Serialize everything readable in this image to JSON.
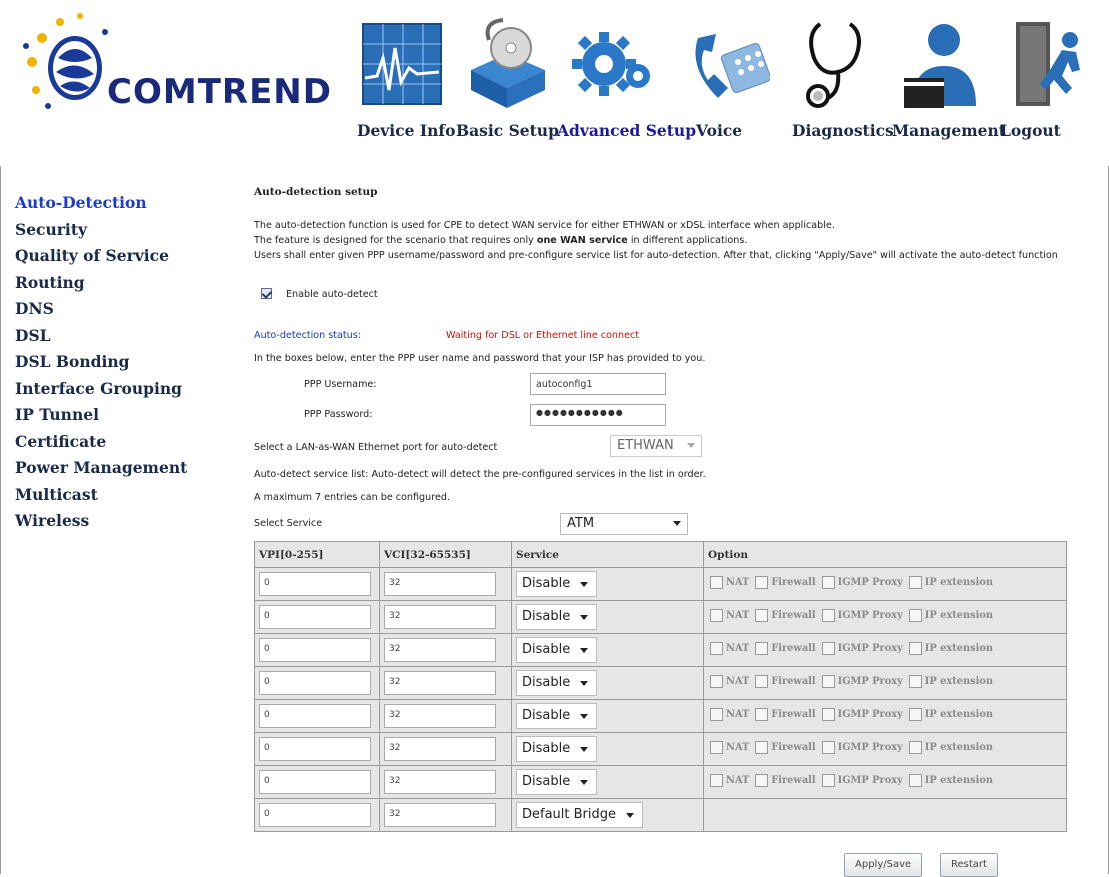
{
  "brand": {
    "name": "COMTREND"
  },
  "nav": [
    {
      "label": "Device Info",
      "icon": "device-info-chart-icon"
    },
    {
      "label": "Basic Setup",
      "icon": "basic-setup-disc-icon"
    },
    {
      "label": "Advanced Setup",
      "icon": "advanced-setup-gear-icon",
      "active": true
    },
    {
      "label": "Voice",
      "icon": "voice-phone-icon"
    },
    {
      "label": "Diagnostics",
      "icon": "diagnostics-stethoscope-icon"
    },
    {
      "label": "Management",
      "icon": "management-person-icon"
    },
    {
      "label": "Logout",
      "icon": "logout-door-icon"
    }
  ],
  "sidebar": {
    "items": [
      {
        "label": "Auto-Detection",
        "active": true
      },
      {
        "label": "Security"
      },
      {
        "label": "Quality of Service"
      },
      {
        "label": "Routing"
      },
      {
        "label": "DNS"
      },
      {
        "label": "DSL"
      },
      {
        "label": "DSL Bonding"
      },
      {
        "label": "Interface Grouping"
      },
      {
        "label": "IP Tunnel"
      },
      {
        "label": "Certificate"
      },
      {
        "label": "Power Management"
      },
      {
        "label": "Multicast"
      },
      {
        "label": "Wireless"
      }
    ]
  },
  "page": {
    "title": "Auto-detection setup",
    "desc1": "The auto-detection function is used for CPE to detect WAN service for either ETHWAN or xDSL interface when applicable.",
    "desc2_pre": "The feature is designed for the scenario that requires only ",
    "desc2_bold": "one WAN service",
    "desc2_post": " in different applications.",
    "desc3": "Users shall enter given PPP username/password and pre-configure service list for auto-detection. After that, clicking \"Apply/Save\" will activate the auto-detect function",
    "enable_label": "Enable auto-detect",
    "enable_checked": true,
    "status_label": "Auto-detection status:",
    "status_value": "Waiting for DSL or Ethernet line connect",
    "ppp_hint": "In the boxes below, enter the PPP user name and password that your ISP has provided to you.",
    "ppp_username_label": "PPP Username:",
    "ppp_username_value": "autoconfig1",
    "ppp_password_label": "PPP Password:",
    "ppp_password_value": "●●●●●●●●●●●",
    "lan_wan_label": "Select a LAN-as-WAN Ethernet port for auto-detect",
    "lan_wan_value": "ETHWAN",
    "service_list_hint": "Auto-detect service list: Auto-detect will detect the pre-configured services in the list in order.",
    "max_entries": "A maximum 7 entries can be configured.",
    "select_service_label": "Select Service",
    "select_service_value": "ATM"
  },
  "table": {
    "headers": {
      "vpi": "VPI[0-255]",
      "vci": "VCI[32-65535]",
      "service": "Service",
      "option": "Option"
    },
    "options": [
      "NAT",
      "Firewall",
      "IGMP Proxy",
      "IP extension"
    ],
    "rows": [
      {
        "vpi": "0",
        "vci": "32",
        "service": "Disable"
      },
      {
        "vpi": "0",
        "vci": "32",
        "service": "Disable"
      },
      {
        "vpi": "0",
        "vci": "32",
        "service": "Disable"
      },
      {
        "vpi": "0",
        "vci": "32",
        "service": "Disable"
      },
      {
        "vpi": "0",
        "vci": "32",
        "service": "Disable"
      },
      {
        "vpi": "0",
        "vci": "32",
        "service": "Disable"
      },
      {
        "vpi": "0",
        "vci": "32",
        "service": "Disable"
      },
      {
        "vpi": "0",
        "vci": "32",
        "service": "Default Bridge",
        "no_options": true
      }
    ]
  },
  "buttons": {
    "apply": "Apply/Save",
    "restart": "Restart"
  }
}
